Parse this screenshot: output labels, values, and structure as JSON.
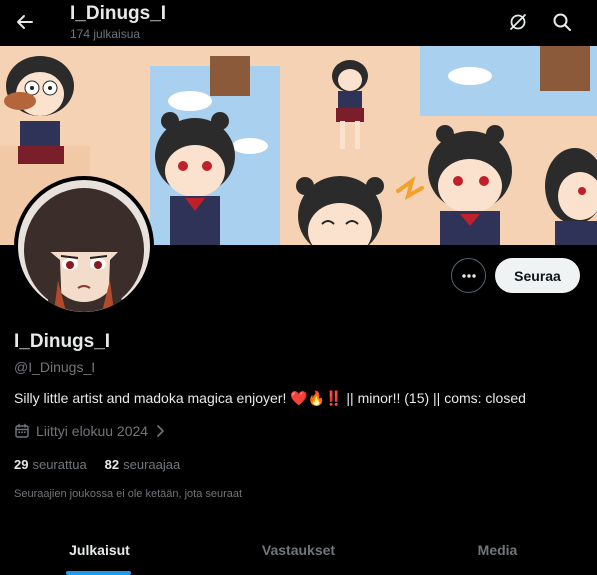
{
  "header": {
    "title": "I_Dinugs_I",
    "post_count": "174 julkaisua",
    "back_icon": "arrow-left-icon",
    "grok_icon": "grok-icon",
    "search_icon": "search-icon"
  },
  "profile": {
    "display_name": "I_Dinugs_I",
    "handle": "@I_Dinugs_I",
    "bio": "Silly little artist and madoka magica enjoyer! ❤️🔥‼️ || minor!! (15) || coms: closed",
    "joined": "Liittyi elokuu 2024",
    "following_count": "29",
    "following_label": "seurattua",
    "followers_count": "82",
    "followers_label": "seuraajaa",
    "followers_note": "Seuraajien joukossa ei ole ketään, jota seuraat"
  },
  "actions": {
    "more_icon": "more-icon",
    "follow_label": "Seuraa"
  },
  "tabs": [
    {
      "label": "Julkaisut",
      "active": true
    },
    {
      "label": "Vastaukset",
      "active": false
    },
    {
      "label": "Media",
      "active": false
    }
  ],
  "colors": {
    "background": "#000000",
    "text": "#e7e9ea",
    "muted": "#71767b",
    "accent": "#1d9bf0",
    "follow_button": "#eff3f4"
  }
}
